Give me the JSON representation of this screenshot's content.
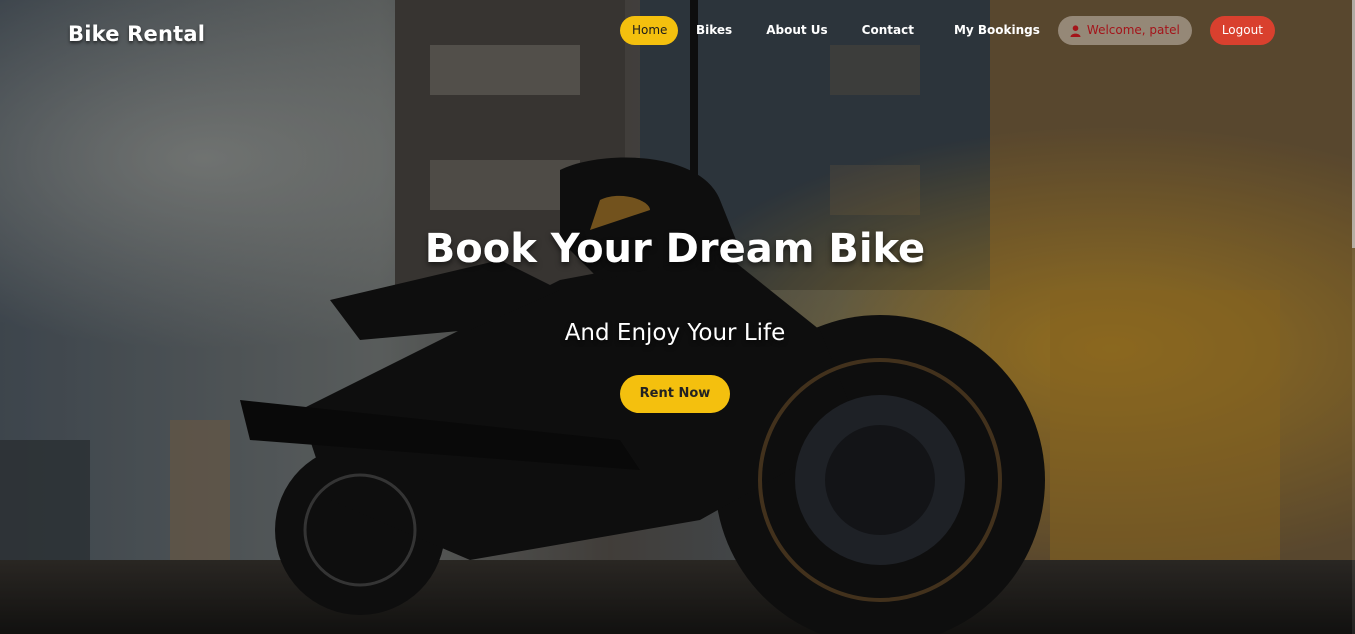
{
  "brand": {
    "name": "Bike Rental"
  },
  "nav": {
    "items": [
      {
        "label": "Home",
        "active": true
      },
      {
        "label": "Bikes"
      },
      {
        "label": "About Us"
      },
      {
        "label": "Contact"
      },
      {
        "label": "My Bookings"
      }
    ],
    "welcome": {
      "label": "Welcome, patel",
      "icon": "user-icon"
    },
    "logout": {
      "label": "Logout"
    }
  },
  "hero": {
    "title": "Book Your Dream Bike",
    "subtitle": "And Enjoy Your Life",
    "cta_label": "Rent Now"
  },
  "colors": {
    "accent": "#f4c00e",
    "logout": "#d9402e",
    "welcome_text": "#a4141a"
  }
}
